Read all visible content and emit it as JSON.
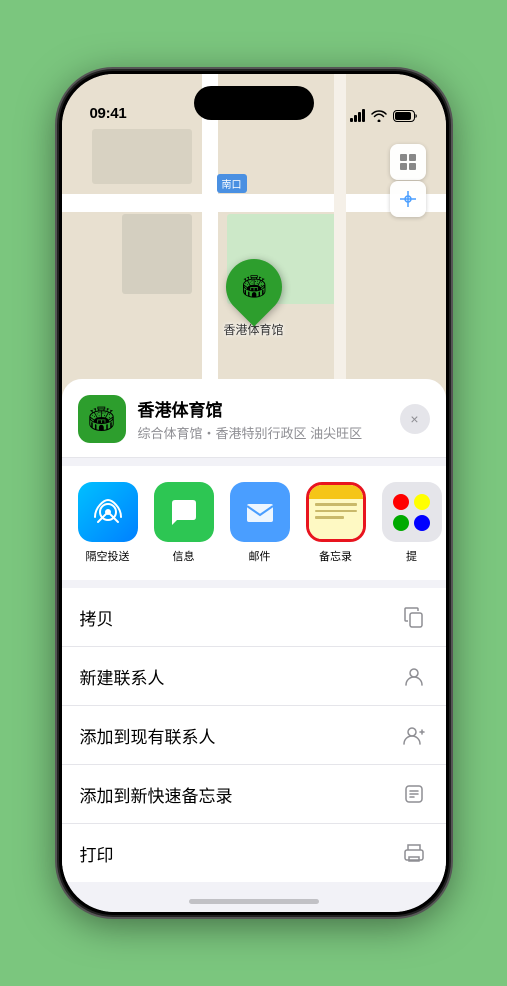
{
  "status": {
    "time": "09:41",
    "location_icon": "▶"
  },
  "map": {
    "label_text": "南口"
  },
  "venue_marker": {
    "label": "香港体育馆",
    "icon": "🏟"
  },
  "sheet": {
    "venue_name": "香港体育馆",
    "venue_subtitle": "综合体育馆・香港特别行政区 油尖旺区",
    "close_label": "×"
  },
  "share_items": [
    {
      "id": "airdrop",
      "label": "隔空投送",
      "type": "airdrop"
    },
    {
      "id": "message",
      "label": "信息",
      "type": "message"
    },
    {
      "id": "mail",
      "label": "邮件",
      "type": "mail"
    },
    {
      "id": "notes",
      "label": "备忘录",
      "type": "notes"
    },
    {
      "id": "more",
      "label": "提",
      "type": "more"
    }
  ],
  "actions": [
    {
      "id": "copy",
      "label": "拷贝",
      "icon": "copy"
    },
    {
      "id": "new-contact",
      "label": "新建联系人",
      "icon": "person"
    },
    {
      "id": "add-contact",
      "label": "添加到现有联系人",
      "icon": "person-add"
    },
    {
      "id": "quick-note",
      "label": "添加到新快速备忘录",
      "icon": "note"
    },
    {
      "id": "print",
      "label": "打印",
      "icon": "print"
    }
  ]
}
